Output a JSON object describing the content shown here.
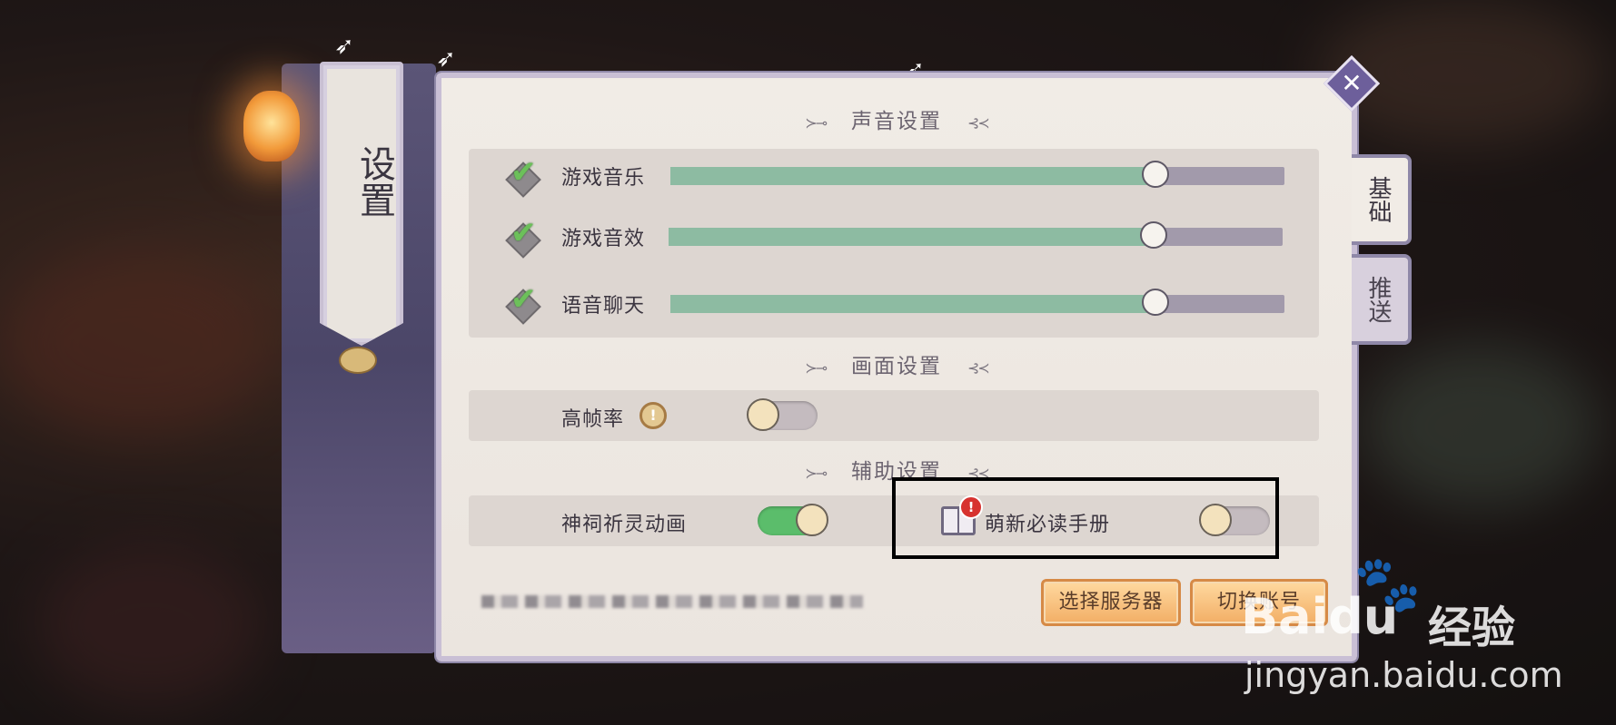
{
  "sidebar": {
    "title": "设置"
  },
  "sound": {
    "heading": "声音设置",
    "items": [
      {
        "label": "游戏音乐",
        "checked": true,
        "level": 0.79
      },
      {
        "label": "游戏音效",
        "checked": true,
        "level": 0.79
      },
      {
        "label": "语音聊天",
        "checked": true,
        "level": 0.79
      }
    ]
  },
  "display": {
    "heading": "画面设置",
    "high_fps": {
      "label": "高帧率",
      "info_icon": "info-icon",
      "enabled": false
    }
  },
  "assist": {
    "heading": "辅助设置",
    "shrine_anim": {
      "label": "神祠祈灵动画",
      "enabled": true
    },
    "newbie_guide": {
      "label": "萌新必读手册",
      "icon": "book-icon",
      "badge": "!",
      "enabled": false
    }
  },
  "buttons": {
    "select_server": "选择服务器",
    "switch_account": "切换账号"
  },
  "tabs": [
    {
      "label": "基础",
      "active": true
    },
    {
      "label": "推送",
      "active": false
    }
  ],
  "close": {
    "icon": "close-icon",
    "glyph": "✕"
  },
  "watermark": {
    "brand": "Bai",
    "brand2": "du",
    "suffix": "经验",
    "url": "jingyan.baidu.com"
  },
  "colors": {
    "slider_fill": "#8dbba2",
    "slider_track": "#a29aab",
    "toggle_on": "#5bbd6b",
    "button": "#f2ae65",
    "accent": "#6d5f9b"
  }
}
